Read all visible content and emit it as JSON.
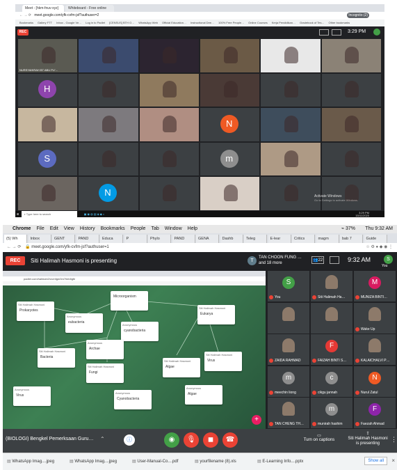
{
  "top": {
    "tab_active": "Meet - [hkm-fnuv-xyz]",
    "tab_2": "Whiteboard - Free online wh…",
    "url": "meet.google.com/yfk-cvfm-jsf?authuser=2",
    "incognito": "Incognito (2)",
    "bookmarks": [
      "Bookmarks",
      "Gallery FTT",
      "Inbox - Google Ve…",
      "Log in to Padlet",
      "[CENSUS] BTH O…",
      "WhatsApp Web",
      "Official Education…",
      "Instructional Dee…",
      "100% Free People…",
      "Online Courses",
      "Kerja Pendidikan…",
      "Gradebook of Tes…",
      "Other bookmarks"
    ],
    "rec": "REC",
    "time": "3:29 PM",
    "tiles": [
      {
        "name": "NURSYAHIRAH BT ABU PU'…",
        "bg": "#5a5a52"
      },
      {
        "name": "",
        "bg": "#3b4b6e"
      },
      {
        "name": "",
        "bg": "#2c2430"
      },
      {
        "name": "",
        "bg": "#6b5a46"
      },
      {
        "name": "",
        "bg": "#e8e8e8"
      },
      {
        "name": "",
        "bg": "#8b8276"
      },
      {
        "name": "",
        "letter": "H",
        "avcolor": "#8e44ad",
        "bg": "#3c4043"
      },
      {
        "name": "",
        "bg": "#3c4043"
      },
      {
        "name": "",
        "bg": "#8f7a5e"
      },
      {
        "name": "",
        "bg": "#4a3a36"
      },
      {
        "name": "",
        "bg": "#3c4043"
      },
      {
        "name": "",
        "bg": "#3c4043"
      },
      {
        "name": "",
        "bg": "#c7b79f"
      },
      {
        "name": "",
        "bg": "#7d7a7e"
      },
      {
        "name": "",
        "bg": "#b08e82"
      },
      {
        "name": "",
        "letter": "N",
        "avcolor": "#ef5a24",
        "bg": "#3c4043"
      },
      {
        "name": "",
        "bg": "#3e4d5c"
      },
      {
        "name": "",
        "bg": "#6a5a4a"
      },
      {
        "name": "",
        "letter": "S",
        "avcolor": "#5c6bc0",
        "bg": "#3c4043"
      },
      {
        "name": "",
        "bg": "#3c4043"
      },
      {
        "name": "",
        "bg": "#3c4043"
      },
      {
        "name": "",
        "letter": "m",
        "avcolor": "#8e8e8e",
        "bg": "#3c4043"
      },
      {
        "name": "",
        "bg": "#ae9a85"
      },
      {
        "name": "",
        "bg": "#3c4043"
      },
      {
        "name": "",
        "bg": "#6b6560"
      },
      {
        "name": "",
        "letter": "N",
        "avcolor": "#039be5",
        "bg": "#3c4043"
      },
      {
        "name": "",
        "bg": "#3c4043"
      },
      {
        "name": "",
        "bg": "#d9cfc6"
      },
      {
        "name": "",
        "bg": "#3c4043"
      },
      {
        "name": "",
        "bg": "#3c4043"
      }
    ],
    "activate_1": "Activate Windows",
    "activate_2": "Go to Settings to activate Windows.",
    "search": "Type here to search",
    "clock": "3:29 PM",
    "date": "15/11/2020"
  },
  "bot": {
    "mac_menu": [
      "Chrome",
      "File",
      "Edit",
      "View",
      "History",
      "Bookmarks",
      "People",
      "Tab",
      "Window",
      "Help"
    ],
    "mac_status": "37%",
    "mac_time": "Thu 9:32 AM",
    "tabs": [
      "(5) Wh",
      "Inbox",
      "GENT",
      "PAND",
      "Educa",
      "P",
      "Phylo",
      "PAND",
      "GENA",
      "Dashb",
      "Teleg",
      "E-lear",
      "Critics",
      "magm",
      "bab 7",
      "Guide"
    ],
    "url": "meet.google.com/yfk-cvfm-jsf?authuser=1",
    "rec": "REC",
    "presenting": "Siti Halimah Hasmoni is presenting",
    "viewer_name": "TAN CHOON FUNG …",
    "viewer_more": "and 18 more",
    "count": "22",
    "time": "9:32 AM",
    "you_label": "You",
    "you_letter": "S",
    "inner_url": "padlet.com/halimah2/ovmfgm3m7hkh8gfe",
    "cards": [
      {
        "hd": "Siti Halimah Hasmoni",
        "bd": "Prokaryotes"
      },
      {
        "hd": "Anonymous",
        "bd": "eubacteria"
      },
      {
        "hd": "",
        "bd": "Microorganism"
      },
      {
        "hd": "Siti Halimah Hasmoni",
        "bd": "Eukarya"
      },
      {
        "hd": "Anonymous",
        "bd": "cyanobacteria"
      },
      {
        "hd": "Anonymous",
        "bd": "Archae"
      },
      {
        "hd": "Siti Halimah Hasmoni",
        "bd": "Bacteria"
      },
      {
        "hd": "Siti Halimah Hasmoni",
        "bd": "Fungi"
      },
      {
        "hd": "Siti Halimah Hasmoni",
        "bd": "Algae"
      },
      {
        "hd": "Siti Halimah Hasmoni",
        "bd": "Virus"
      },
      {
        "hd": "Anonymous",
        "bd": "Virus"
      },
      {
        "hd": "Anonymous",
        "bd": "Cyanobacteria"
      },
      {
        "hd": "Anonymous",
        "bd": "Algae"
      }
    ],
    "participants": [
      {
        "name": "You",
        "letter": "S",
        "color": "#43a047"
      },
      {
        "name": "Siti Halimah Ha…",
        "letter": "",
        "color": ""
      },
      {
        "name": "MUNIZA BINTI…",
        "letter": "M",
        "color": "#d81b60"
      },
      {
        "name": "",
        "letter": "",
        "color": ""
      },
      {
        "name": "",
        "letter": "",
        "color": ""
      },
      {
        "name": "Wake Up",
        "letter": "",
        "color": ""
      },
      {
        "name": "ZAIDA RAHMAD",
        "letter": "",
        "color": ""
      },
      {
        "name": "FAIZAH BINTI S…",
        "letter": "F",
        "color": "#e53935"
      },
      {
        "name": "KALAICHALVI P…",
        "letter": "",
        "color": ""
      },
      {
        "name": "meechin liong",
        "letter": "m",
        "color": "#8e8e8e"
      },
      {
        "name": "cikgu jannah",
        "letter": "c",
        "color": "#8e8e8e"
      },
      {
        "name": "Nurul Zatul",
        "letter": "N",
        "color": "#ef5a24"
      },
      {
        "name": "TAN CHENG TH…",
        "letter": "",
        "color": ""
      },
      {
        "name": "munirah hashim",
        "letter": "m",
        "color": "#8e8e8e"
      },
      {
        "name": "Faezah Ahmad",
        "letter": "F",
        "color": "#8e24aa"
      }
    ],
    "meeting_title": "(BIOLOGI) Bengkel Pemerksaan Guru…",
    "captions": "Turn on captions",
    "presenter_box_1": "Siti Halimah Hasmoni",
    "presenter_box_2": "is presenting",
    "downloads": [
      "WhatsApp Imag....jpeg",
      "WhatsApp Imag....jpeg",
      "User-Manual-Co....pdf",
      "yourfilename (8).xls",
      "E-Learning Info....pptx"
    ],
    "show_all": "Show all"
  }
}
